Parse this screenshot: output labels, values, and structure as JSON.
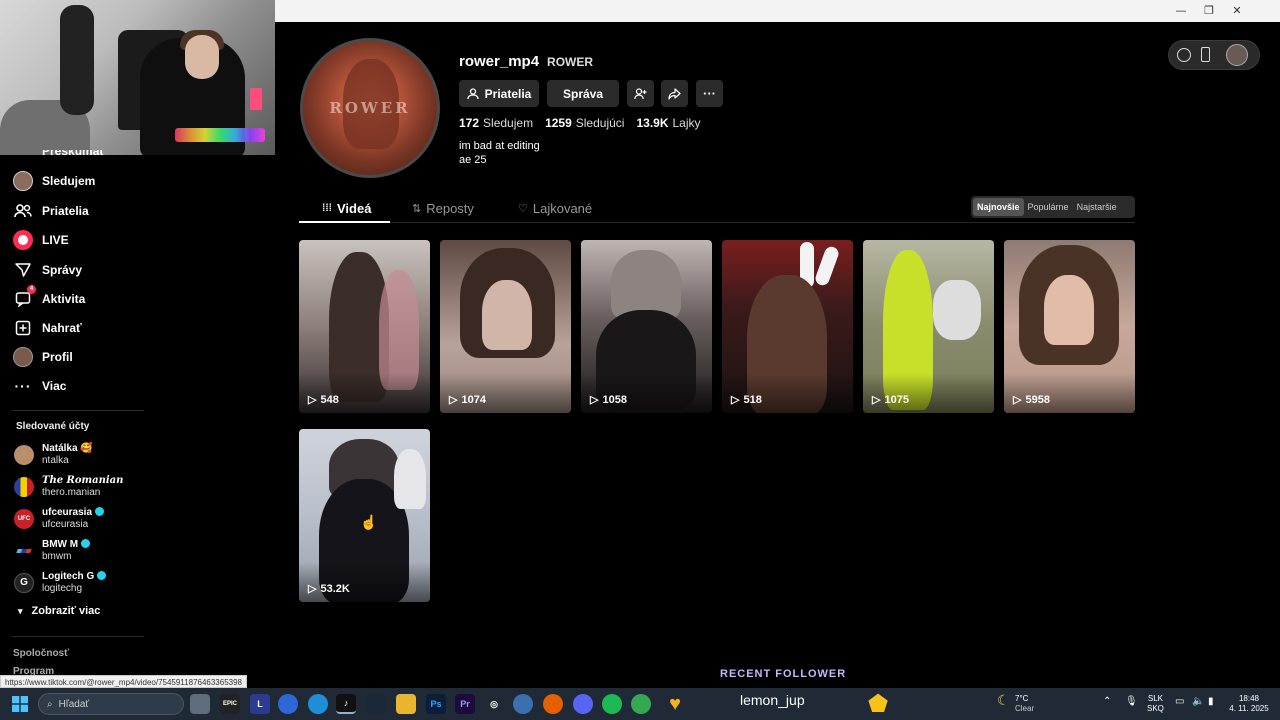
{
  "window": {
    "minimize": "—",
    "restore": "❐",
    "close": "✕"
  },
  "sidebar": {
    "partial_item": "Preskúmať",
    "items": [
      {
        "label": "Sledujem",
        "icon": "following-avatar-icon"
      },
      {
        "label": "Priatelia",
        "icon": "friends-icon"
      },
      {
        "label": "LIVE",
        "icon": "live-icon"
      },
      {
        "label": "Správy",
        "icon": "messages-icon"
      },
      {
        "label": "Aktivita",
        "icon": "activity-icon",
        "badge": "4"
      },
      {
        "label": "Nahrať",
        "icon": "upload-icon"
      },
      {
        "label": "Profil",
        "icon": "profile-icon"
      },
      {
        "label": "Viac",
        "icon": "more-icon"
      }
    ],
    "following_title": "Sledované účty",
    "accounts": [
      {
        "name": "Natálka 🥰",
        "handle": "ntalka",
        "color": "#b98f6b",
        "verified": false
      },
      {
        "name": "𝑻𝒉𝒆 𝑹𝒐𝒎𝒂𝒏𝒊𝒂𝒏",
        "handle": "thero.manian",
        "color": "#2a3fa0",
        "verified": false
      },
      {
        "name": "ufceurasia",
        "handle": "ufceurasia",
        "color": "#c8202a",
        "verified": true
      },
      {
        "name": "BMW M",
        "handle": "bmwm",
        "color": "#111111",
        "verified": true
      },
      {
        "name": "Logitech G",
        "handle": "logitechg",
        "color": "#222222",
        "verified": true
      }
    ],
    "show_more": "Zobraziť viac",
    "footer_1": "Spoločnosť",
    "footer_2": "Program"
  },
  "profile": {
    "username": "rower_mp4",
    "nickname": "ROWER",
    "avatar_text": "ROWER",
    "friends_btn": "Priatelia",
    "message_btn": "Správa",
    "stats": [
      {
        "value": "172",
        "label": "Sledujem"
      },
      {
        "value": "1259",
        "label": "Sledujúci"
      },
      {
        "value": "13.9K",
        "label": "Lajky"
      }
    ],
    "bio_1": "im bad at editing",
    "bio_2": "ae 25"
  },
  "tabs": {
    "videos": "Videá",
    "reposts": "Reposty",
    "liked": "Lajkované"
  },
  "sort": {
    "newest": "Najnovšie",
    "popular": "Populárne",
    "oldest": "Najstaršie"
  },
  "videos": [
    {
      "views": "548"
    },
    {
      "views": "1074"
    },
    {
      "views": "1058"
    },
    {
      "views": "518"
    },
    {
      "views": "1075"
    },
    {
      "views": "5958"
    },
    {
      "views": "53.2K"
    }
  ],
  "status_url": "https://www.tiktok.com/@rower_mp4/video/7545911876463365398",
  "overlay": {
    "recent_follower_label": "RECENT FOLLOWER",
    "recent_follower_name": "lemon_jup"
  },
  "taskbar": {
    "search_placeholder": "Hľadať",
    "weather_temp": "7°C",
    "weather_desc": "Clear",
    "lang_1": "SLK",
    "lang_2": "SKQ",
    "time": "18:48",
    "date": "4. 11. 2025"
  }
}
